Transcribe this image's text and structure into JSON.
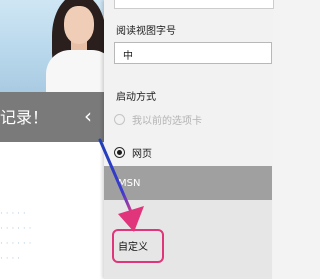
{
  "background": {
    "banner_text": "记录！",
    "carousel_prev_icon": "chevron-left-icon",
    "links": [
      "·  ·  ·  ·  ·",
      "·  ·  ·  ·  ·  ·",
      "·  ·  ·  ·  ·  ·",
      "·  ·  ·  ·"
    ]
  },
  "settings": {
    "top_select_value": "",
    "zoom_label": "阅读视图字号",
    "zoom_value": "中",
    "startup_label": "启动方式",
    "startup_options": {
      "previous_tabs": "我以前的选项卡",
      "webpage": "网页"
    },
    "webpage_dropdown": {
      "msn": "MSN",
      "blank": "",
      "custom": "自定义"
    }
  },
  "colors": {
    "highlight": "#e0357a",
    "arrow": "#1f3fb8",
    "msn_bg": "#a0a0a0"
  }
}
